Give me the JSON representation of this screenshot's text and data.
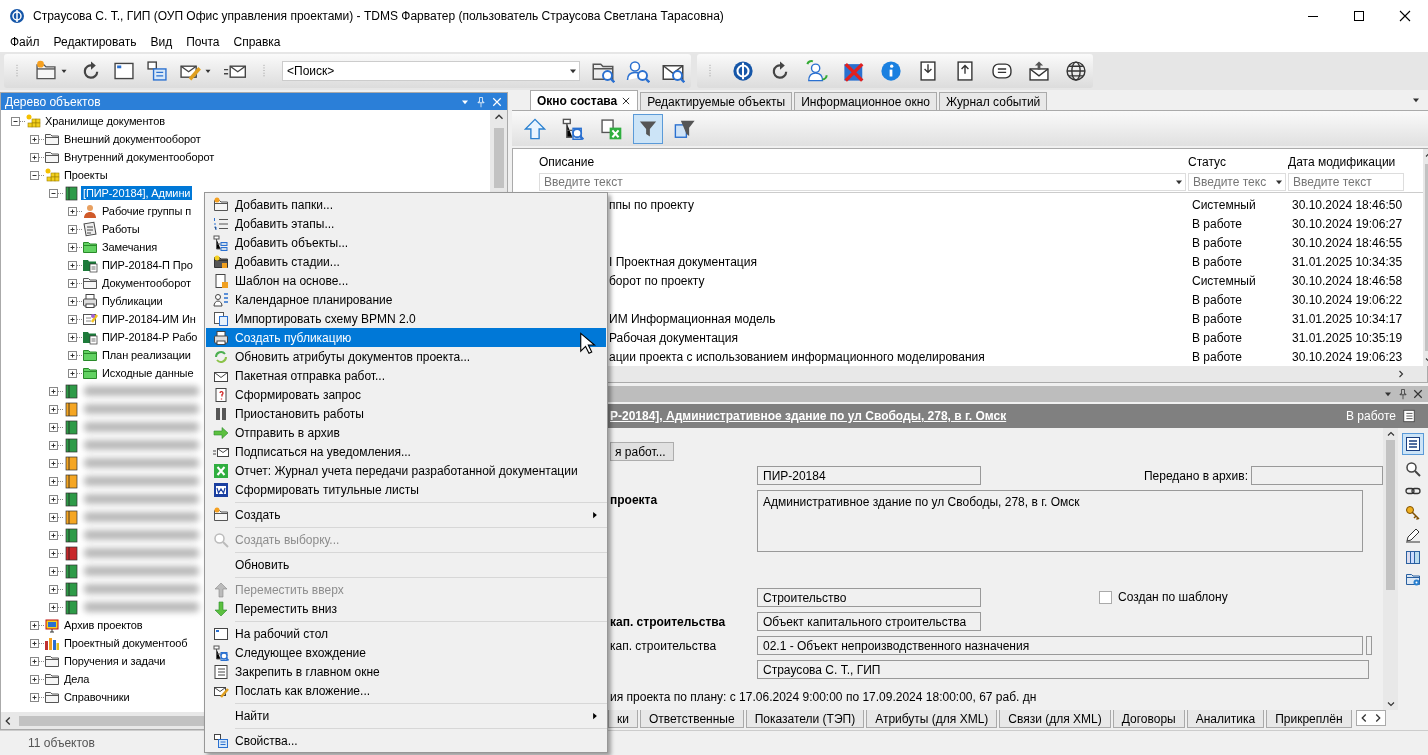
{
  "window": {
    "title": "Страусова С. Т., ГИП (ОУП Офис управления проектами) - TDMS Фарватер (пользователь Страусова Светлана Тарасовна)"
  },
  "menu": [
    "Файл",
    "Редактировать",
    "Вид",
    "Почта",
    "Справка"
  ],
  "toolbar": {
    "search": {
      "value": "<Поиск>"
    }
  },
  "tree": {
    "title": "Дерево объектов",
    "items": [
      {
        "label": "Хранилище документов",
        "kind": "storage",
        "expanded": true,
        "selected": false,
        "children": [
          {
            "label": "Внешний документооборот",
            "kind": "folder",
            "expanded": false,
            "selected": false
          },
          {
            "label": "Внутренний документооборот",
            "kind": "folder",
            "expanded": false,
            "selected": false
          },
          {
            "label": "Проекты",
            "kind": "storage",
            "expanded": true,
            "selected": false,
            "children": [
              {
                "label": "[ПИР-20184], Админи",
                "kind": "project",
                "expanded": true,
                "selected": true,
                "children": [
                  {
                    "label": "Рабочие группы п",
                    "kind": "team",
                    "expanded": false,
                    "selected": false
                  },
                  {
                    "label": "Работы",
                    "kind": "works",
                    "expanded": false,
                    "selected": false
                  },
                  {
                    "label": "Замечания",
                    "kind": "subfolder",
                    "expanded": false,
                    "selected": false
                  },
                  {
                    "label": "ПИР-20184-П Про",
                    "kind": "section",
                    "expanded": false,
                    "selected": false
                  },
                  {
                    "label": "Документооборот",
                    "kind": "folder",
                    "expanded": false,
                    "selected": false
                  },
                  {
                    "label": "Публикации",
                    "kind": "publications",
                    "expanded": false,
                    "selected": false
                  },
                  {
                    "label": "ПИР-20184-ИМ Ин",
                    "kind": "model",
                    "expanded": false,
                    "selected": false
                  },
                  {
                    "label": "ПИР-20184-Р Рабо",
                    "kind": "section",
                    "expanded": false,
                    "selected": false
                  },
                  {
                    "label": "План реализации",
                    "kind": "subfolder",
                    "expanded": false,
                    "selected": false
                  },
                  {
                    "label": "Исходные данные",
                    "kind": "subfolder",
                    "expanded": false,
                    "selected": false
                  }
                ]
              },
              {
                "kind": "blurred",
                "color": "#2e9b48",
                "expanded": false,
                "selected": false
              },
              {
                "kind": "blurred",
                "color": "#f5a623",
                "expanded": false,
                "selected": false
              },
              {
                "kind": "blurred",
                "color": "#2e9b48",
                "expanded": false,
                "selected": false
              },
              {
                "kind": "blurred",
                "color": "#2e9b48",
                "expanded": false,
                "selected": false
              },
              {
                "kind": "blurred",
                "color": "#f5a623",
                "expanded": false,
                "selected": false
              },
              {
                "kind": "blurred",
                "color": "#f5a623",
                "expanded": false,
                "selected": false
              },
              {
                "kind": "blurred",
                "color": "#2e9b48",
                "expanded": false,
                "selected": false
              },
              {
                "kind": "blurred",
                "color": "#f5a623",
                "expanded": false,
                "selected": false
              },
              {
                "kind": "blurred",
                "color": "#2e9b48",
                "expanded": false,
                "selected": false
              },
              {
                "kind": "blurred",
                "color": "#c8282b",
                "expanded": false,
                "selected": false
              },
              {
                "kind": "blurred",
                "color": "#2e9b48",
                "expanded": false,
                "selected": false
              },
              {
                "kind": "blurred",
                "color": "#2e9b48",
                "expanded": false,
                "selected": false
              },
              {
                "kind": "blurred",
                "color": "#2e9b48",
                "expanded": false,
                "selected": false
              }
            ]
          },
          {
            "label": "Архив проектов",
            "kind": "archive",
            "expanded": false,
            "selected": false
          },
          {
            "label": "Проектный документооб",
            "kind": "library",
            "expanded": false,
            "selected": false
          },
          {
            "label": "Поручения и задачи",
            "kind": "folder",
            "expanded": false,
            "selected": false
          },
          {
            "label": "Дела",
            "kind": "folder",
            "expanded": false,
            "selected": false
          },
          {
            "label": "Справочники",
            "kind": "folder",
            "expanded": false,
            "selected": false
          }
        ]
      }
    ]
  },
  "tabs": [
    {
      "label": "Окно состава",
      "selected": true
    },
    {
      "label": "Редактируемые объекты",
      "selected": false
    },
    {
      "label": "Информационное окно",
      "selected": false
    },
    {
      "label": "Журнал событий",
      "selected": false
    }
  ],
  "table": {
    "columns": [
      "Описание",
      "Статус",
      "Дата модификации"
    ],
    "filters": [
      {
        "placeholder": "Введите текст"
      },
      {
        "placeholder": "Введите текс"
      },
      {
        "placeholder": "Введите текст"
      }
    ],
    "rows": [
      {
        "description": "ппы по проекту",
        "status": "Системный",
        "modified": "30.10.2024 18:46:50"
      },
      {
        "status": "В работе",
        "modified": "30.10.2024 19:06:27"
      },
      {
        "status": "В работе",
        "modified": "30.10.2024 18:46:55"
      },
      {
        "description": "I Проектная документация",
        "status": "В работе",
        "modified": "31.01.2025 10:34:35"
      },
      {
        "description": "борот по проекту",
        "status": "Системный",
        "modified": "30.10.2024 18:46:58"
      },
      {
        "status": "В работе",
        "modified": "30.10.2024 19:06:22"
      },
      {
        "description": "ИМ Информационная модель",
        "status": "В работе",
        "modified": "31.01.2025 10:34:17"
      },
      {
        "description": "Рабочая документация",
        "status": "В работе",
        "modified": "31.01.2025 10:35:19"
      },
      {
        "description": "ации проекта с использованием информационного моделирования",
        "status": "В работе",
        "modified": "30.10.2024 19:06:23"
      }
    ]
  },
  "card": {
    "title": "Р-20184], Административное здание по ул Свободы, 278, в г. Омск",
    "status": "В работе",
    "button": "я работ...",
    "fields": [
      {
        "kind": "text",
        "value": "ПИР-20184",
        "side_label": "Передано в архив:"
      },
      {
        "kind": "memo",
        "label": "проекта",
        "required": true,
        "value": "Административное здание по ул Свободы, 278, в г. Омск"
      },
      {
        "kind": "text",
        "value": "Строительство",
        "checkbox": {
          "label": "Создан по шаблону",
          "checked": false
        }
      },
      {
        "kind": "text",
        "label": "кап. строительства",
        "required": true,
        "value": "Объект капитального строительства"
      },
      {
        "kind": "select",
        "label": "кап. строительства",
        "required": false,
        "value": "02.1 - Объект непроизводственного назначения"
      },
      {
        "kind": "wide",
        "value": "Страусова С. Т., ГИП"
      }
    ],
    "plan": "ия проекта по плану: с 17.06.2024 9:00:00 по 17.09.2024 18:00:00, 67 раб. дн",
    "tabs": [
      {
        "label": "ки",
        "selected": false
      },
      {
        "label": "Ответственные",
        "selected": false
      },
      {
        "label": "Показатели (ТЭП)",
        "selected": false
      },
      {
        "label": "Атрибуты (для XML)",
        "selected": false
      },
      {
        "label": "Связи (для XML)",
        "selected": false
      },
      {
        "label": "Договоры",
        "selected": false
      },
      {
        "label": "Аналитика",
        "selected": false
      },
      {
        "label": "Прикреплён",
        "selected": false
      }
    ]
  },
  "context_menu": [
    {
      "kind": "item",
      "label": "Добавить папки...",
      "selected": false,
      "disabled": false,
      "submenu": false
    },
    {
      "kind": "item",
      "label": "Добавить этапы...",
      "selected": false,
      "disabled": false,
      "submenu": false
    },
    {
      "kind": "item",
      "label": "Добавить объекты...",
      "selected": false,
      "disabled": false,
      "submenu": false
    },
    {
      "kind": "item",
      "label": "Добавить стадии...",
      "selected": false,
      "disabled": false,
      "submenu": false
    },
    {
      "kind": "item",
      "label": "Шаблон на основе...",
      "selected": false,
      "disabled": false,
      "submenu": false
    },
    {
      "kind": "item",
      "label": "Календарное планирование",
      "selected": false,
      "disabled": false,
      "submenu": false
    },
    {
      "kind": "item",
      "label": "Импортировать схему BPMN 2.0",
      "selected": false,
      "disabled": false,
      "submenu": false
    },
    {
      "kind": "item",
      "label": "Создать публикацию",
      "selected": true,
      "disabled": false,
      "submenu": false
    },
    {
      "kind": "item",
      "label": "Обновить атрибуты документов проекта...",
      "selected": false,
      "disabled": false,
      "submenu": false
    },
    {
      "kind": "item",
      "label": "Пакетная отправка работ...",
      "selected": false,
      "disabled": false,
      "submenu": false
    },
    {
      "kind": "item",
      "label": "Сформировать запрос",
      "selected": false,
      "disabled": false,
      "submenu": false
    },
    {
      "kind": "item",
      "label": "Приостановить работы",
      "selected": false,
      "disabled": false,
      "submenu": false
    },
    {
      "kind": "item",
      "label": "Отправить в архив",
      "selected": false,
      "disabled": false,
      "submenu": false
    },
    {
      "kind": "item",
      "label": "Подписаться на уведомления...",
      "selected": false,
      "disabled": false,
      "submenu": false
    },
    {
      "kind": "item",
      "label": "Отчет: Журнал учета передачи разработанной документации",
      "selected": false,
      "disabled": false,
      "submenu": false
    },
    {
      "kind": "item",
      "label": "Сформировать титульные листы",
      "selected": false,
      "disabled": false,
      "submenu": false
    },
    {
      "kind": "separator"
    },
    {
      "kind": "item",
      "label": "Создать",
      "selected": false,
      "disabled": false,
      "submenu": true
    },
    {
      "kind": "separator"
    },
    {
      "kind": "item",
      "label": "Создать выборку...",
      "selected": false,
      "disabled": true,
      "submenu": false
    },
    {
      "kind": "separator"
    },
    {
      "kind": "item",
      "label": "Обновить",
      "selected": false,
      "disabled": false,
      "submenu": false
    },
    {
      "kind": "separator"
    },
    {
      "kind": "item",
      "label": "Переместить вверх",
      "selected": false,
      "disabled": true,
      "submenu": false
    },
    {
      "kind": "item",
      "label": "Переместить вниз",
      "selected": false,
      "disabled": false,
      "submenu": false
    },
    {
      "kind": "separator"
    },
    {
      "kind": "item",
      "label": "На рабочий стол",
      "selected": false,
      "disabled": false,
      "submenu": false
    },
    {
      "kind": "item",
      "label": "Следующее вхождение",
      "selected": false,
      "disabled": false,
      "submenu": false
    },
    {
      "kind": "item",
      "label": "Закрепить в главном окне",
      "selected": false,
      "disabled": false,
      "submenu": false
    },
    {
      "kind": "item",
      "label": "Послать как вложение...",
      "selected": false,
      "disabled": false,
      "submenu": false
    },
    {
      "kind": "separator"
    },
    {
      "kind": "item",
      "label": "Найти",
      "selected": false,
      "disabled": false,
      "submenu": true
    },
    {
      "kind": "separator"
    },
    {
      "kind": "item",
      "label": "Свойства...",
      "selected": false,
      "disabled": false,
      "submenu": false
    }
  ],
  "status_bar": "11 объектов"
}
